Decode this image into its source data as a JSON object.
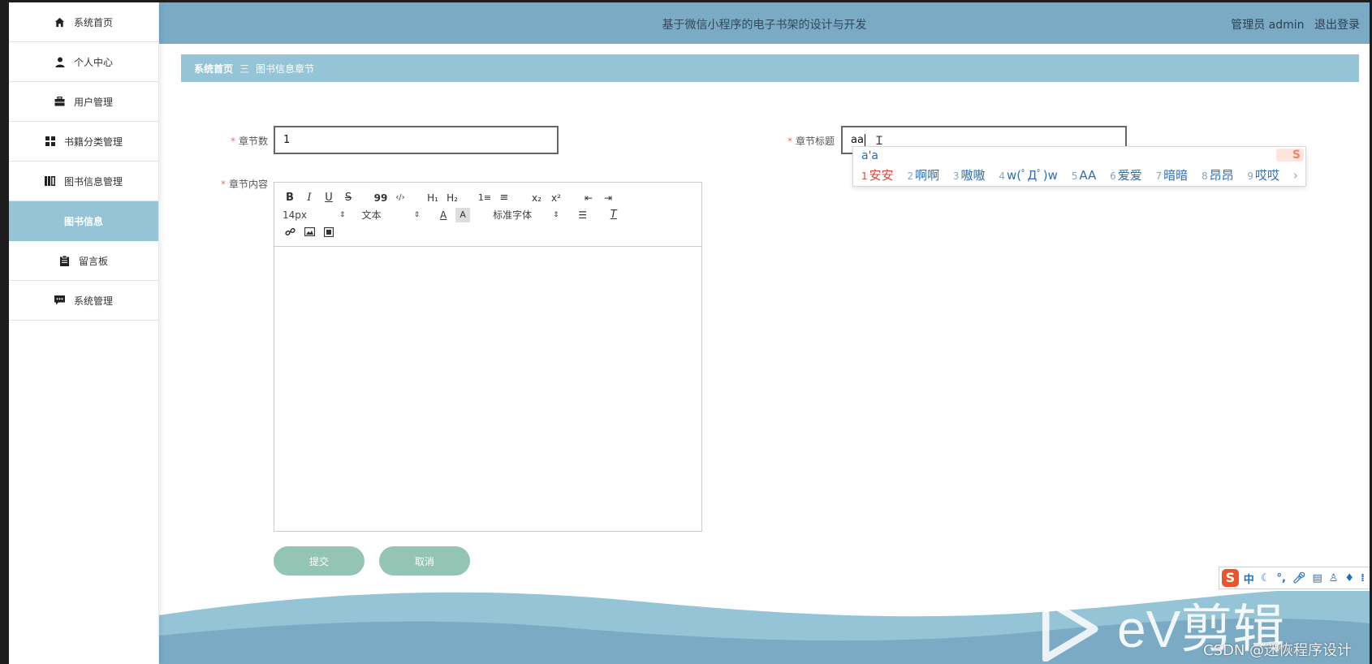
{
  "header": {
    "title": "基于微信小程序的电子书架的设计与开发",
    "user_label": "管理员 admin",
    "logout_label": "退出登录"
  },
  "sidebar": {
    "items": [
      {
        "label": "系统首页",
        "icon": "home-icon"
      },
      {
        "label": "个人中心",
        "icon": "user-icon"
      },
      {
        "label": "用户管理",
        "icon": "briefcase-icon"
      },
      {
        "label": "书籍分类管理",
        "icon": "grid-icon"
      },
      {
        "label": "图书信息管理",
        "icon": "book-icon"
      },
      {
        "label": "图书信息",
        "icon": "",
        "active": true
      },
      {
        "label": "留言板",
        "icon": "clipboard-icon"
      },
      {
        "label": "系统管理",
        "icon": "chat-icon"
      }
    ]
  },
  "breadcrumb": {
    "home": "系统首页",
    "separator": "三",
    "current": "图书信息章节"
  },
  "form": {
    "chapter_no_label": "章节数",
    "chapter_no_value": "1",
    "chapter_title_label": "章节标题",
    "chapter_title_value": "aa",
    "content_label": "章节内容",
    "required_mark": "*"
  },
  "editor": {
    "font_size": "14px",
    "paragraph": "文本",
    "font_family": "标准字体",
    "buttons": [
      "B",
      "I",
      "U",
      "S",
      "99",
      "‹/›",
      "H₁",
      "H₂",
      "1≡",
      "≡",
      "x₂",
      "x²",
      "⇤",
      "⇥"
    ]
  },
  "actions": {
    "submit_label": "提交",
    "cancel_label": "取消"
  },
  "ime": {
    "pinyin": "a'a",
    "candidates": [
      {
        "n": "1",
        "text": "安安"
      },
      {
        "n": "2",
        "text": "啊啊"
      },
      {
        "n": "3",
        "text": "嗷嗷"
      },
      {
        "n": "4",
        "text": "w(ﾟДﾟ)w"
      },
      {
        "n": "5",
        "text": "AA"
      },
      {
        "n": "6",
        "text": "爱爱"
      },
      {
        "n": "7",
        "text": "暗暗"
      },
      {
        "n": "8",
        "text": "昂昂"
      },
      {
        "n": "9",
        "text": "哎哎"
      }
    ],
    "next": "›",
    "logo": "S",
    "bar_logo": "S",
    "bar_mode": "中"
  },
  "watermark": {
    "ev_text": "eV剪辑",
    "csdn": "CSDN @迷恢程序设计"
  },
  "colors": {
    "header": "#7aaac4",
    "breadcrumb": "#94c4d6",
    "active_menu": "#94c4d6",
    "button": "#93c4b4",
    "required": "#f56c6c"
  }
}
